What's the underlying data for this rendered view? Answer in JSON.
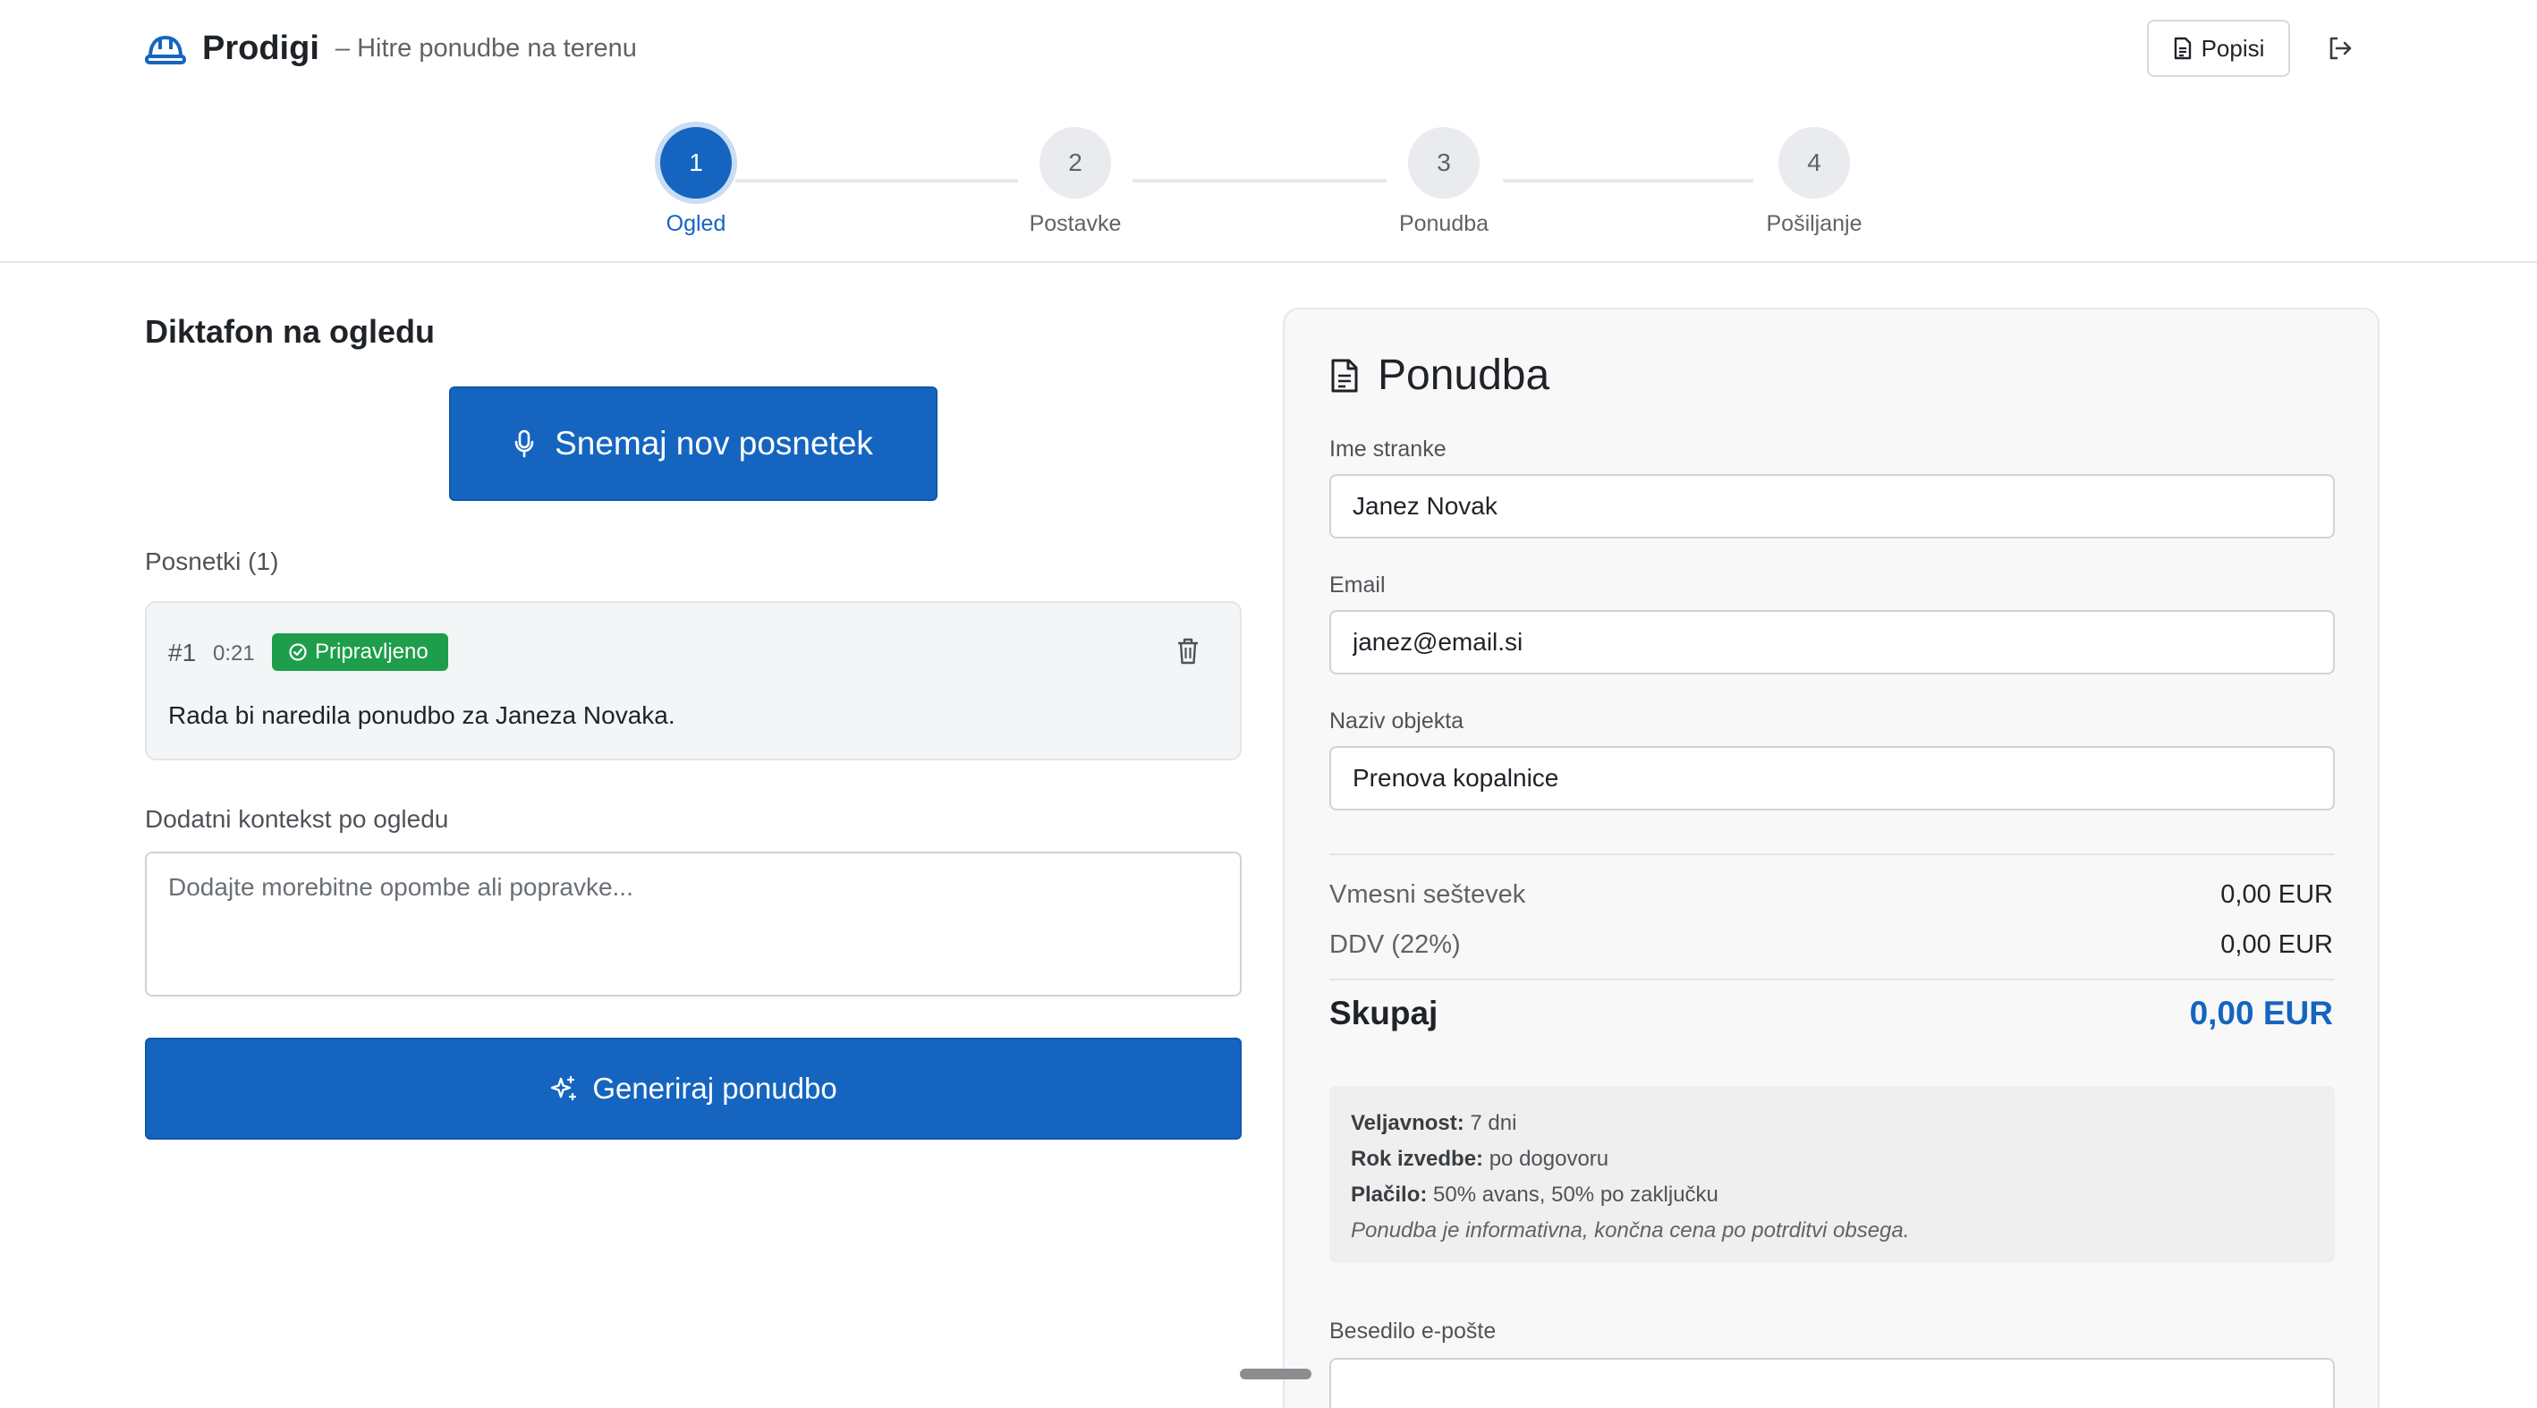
{
  "app": {
    "name": "Prodigi",
    "subtitle": "– Hitre ponudbe na terenu",
    "brand_icon": "hard-hat-icon",
    "accent_color": "#1565c0"
  },
  "header": {
    "popisi_label": "Popisi",
    "popisi_icon": "document-icon",
    "logout_icon": "logout-icon"
  },
  "stepper": {
    "steps": [
      {
        "number": "1",
        "label": "Ogled",
        "active": true
      },
      {
        "number": "2",
        "label": "Postavke",
        "active": false
      },
      {
        "number": "3",
        "label": "Ponudba",
        "active": false
      },
      {
        "number": "4",
        "label": "Pošiljanje",
        "active": false
      }
    ]
  },
  "recorder": {
    "title": "Diktafon na ogledu",
    "record_button": "Snemaj nov posnetek",
    "recordings_label": "Posnetki (1)",
    "recordings": [
      {
        "number": "#1",
        "duration": "0:21",
        "status": "Pripravljeno",
        "status_color": "#1e9e4a",
        "transcript": "Rada bi naredila ponudbo za Janeza Novaka."
      }
    ],
    "context_label": "Dodatni kontekst po ogledu",
    "context_placeholder": "Dodajte morebitne opombe ali popravke...",
    "generate_button": "Generiraj ponudbo"
  },
  "offer": {
    "title": "Ponudba",
    "fields": {
      "client_label": "Ime stranke",
      "client_value": "Janez Novak",
      "email_label": "Email",
      "email_value": "janez@email.si",
      "object_label": "Naziv objekta",
      "object_value": "Prenova kopalnice"
    },
    "summary": {
      "subtotal_label": "Vmesni seštevek",
      "subtotal_value": "0,00 EUR",
      "vat_label": "DDV (22%)",
      "vat_value": "0,00 EUR",
      "total_label": "Skupaj",
      "total_value": "0,00 EUR"
    },
    "terms": {
      "validity_label": "Veljavnost:",
      "validity_value": " 7 dni",
      "deadline_label": "Rok izvedbe:",
      "deadline_value": " po dogovoru",
      "payment_label": "Plačilo:",
      "payment_value": " 50% avans, 50% po zaključku",
      "note": "Ponudba je informativna, končna cena po potrditvi obsega."
    },
    "email_body_label": "Besedilo e-pošte"
  }
}
